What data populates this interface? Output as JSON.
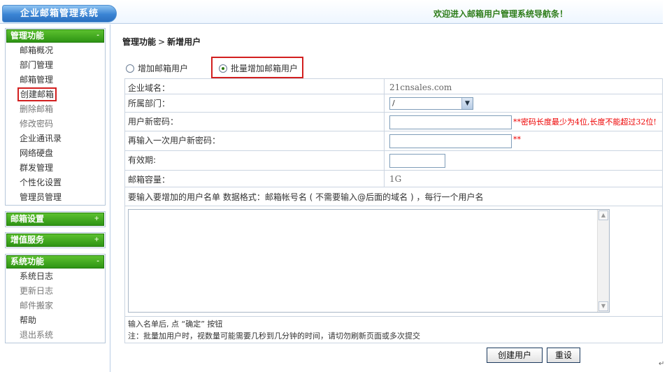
{
  "header": {
    "app_title": "企业邮箱管理系统",
    "welcome": "欢迎进入邮箱用户管理系统导航条！"
  },
  "sidebar": {
    "sections": [
      {
        "title": "管理功能",
        "toggle": "-",
        "items": [
          "邮箱概况",
          "部门管理",
          "邮箱管理",
          "创建邮箱",
          "删除邮箱",
          "修改密码",
          "企业通讯录",
          "网络硬盘",
          "群发管理",
          "个性化设置",
          "管理员管理"
        ]
      },
      {
        "title": "邮箱设置",
        "toggle": "+"
      },
      {
        "title": "增值服务",
        "toggle": "+"
      },
      {
        "title": "系统功能",
        "toggle": "-",
        "items": [
          "系统日志",
          "更新日志",
          "邮件搬家",
          "帮助",
          "退出系统"
        ]
      }
    ],
    "active_item": "创建邮箱"
  },
  "main": {
    "breadcrumb": {
      "section": "管理功能",
      "separator": ">",
      "page": "新增用户"
    },
    "mode": {
      "single_label": "增加邮箱用户",
      "batch_label": "批量增加邮箱用户",
      "selected": "batch"
    },
    "form": {
      "domain_label": "企业域名：",
      "domain_value": "21cnsales.com",
      "dept_label": "所属部门：",
      "dept_value": "/",
      "password_label": "用户新密码：",
      "password_hint": "**密码长度最少为4位,长度不能超过32位!",
      "confirm_label": "再输入一次用户新密码：",
      "confirm_hint": "**",
      "expiry_label": "有效期:",
      "capacity_label": "邮箱容量：",
      "capacity_value": "1G",
      "instructions": "要输入要增加的用户名单 数据格式：邮箱帐号名 ( 不需要输入@后面的域名 ) ，每行一个用户名",
      "note_line1": "输入名单后, 点 “确定” 按钮",
      "note_line2": "注：批量加用户时，视数量可能需要几秒到几分钟的时间，请切勿刷新页面或多次提交"
    },
    "buttons": {
      "create": "创建用户",
      "reset": "重设"
    }
  },
  "colors": {
    "menu_green": "#2e9414",
    "header_blue": "#3a84d4",
    "welcome_green": "#2e7d1a",
    "highlight_red": "#d21f1f",
    "hint_red": "#e00000"
  }
}
